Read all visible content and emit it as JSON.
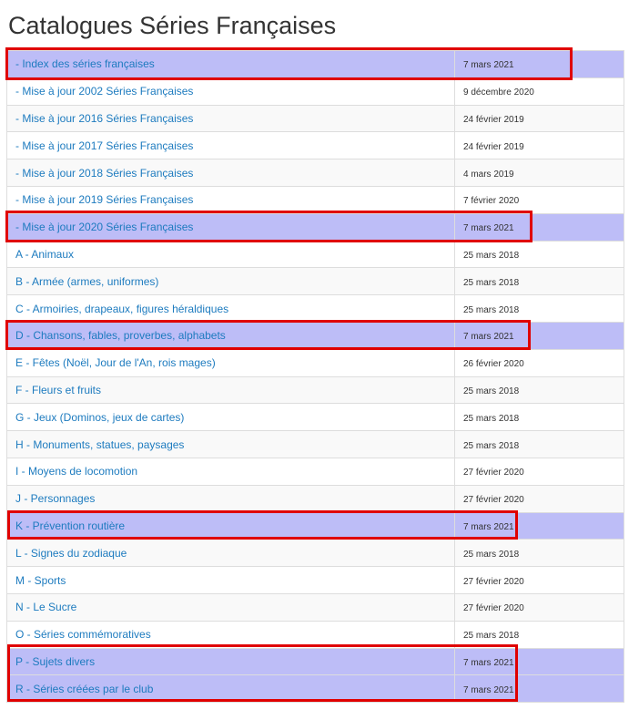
{
  "title": "Catalogues Séries Françaises",
  "highlight_color": "#bdbdf7",
  "box_color": "#e00000",
  "link_color": "#1d7bbf",
  "rows": [
    {
      "label": "- Index des séries françaises",
      "date": "7 mars 2021",
      "highlighted": true
    },
    {
      "label": "- Mise à jour 2002 Séries Françaises",
      "date": "9 décembre 2020",
      "highlighted": false
    },
    {
      "label": "- Mise à jour 2016 Séries Françaises",
      "date": "24 février 2019",
      "highlighted": false
    },
    {
      "label": "- Mise à jour 2017 Séries Françaises",
      "date": "24 février 2019",
      "highlighted": false
    },
    {
      "label": "- Mise à jour 2018 Séries Françaises",
      "date": "4 mars 2019",
      "highlighted": false
    },
    {
      "label": "- Mise à jour 2019 Séries Françaises",
      "date": "7 février 2020",
      "highlighted": false
    },
    {
      "label": "- Mise à jour 2020 Séries Françaises",
      "date": "7 mars 2021",
      "highlighted": true
    },
    {
      "label": "A - Animaux",
      "date": "25 mars 2018",
      "highlighted": false
    },
    {
      "label": "B - Armée (armes, uniformes)",
      "date": "25 mars 2018",
      "highlighted": false
    },
    {
      "label": "C - Armoiries, drapeaux, figures héraldiques",
      "date": "25 mars 2018",
      "highlighted": false
    },
    {
      "label": "D - Chansons, fables, proverbes, alphabets",
      "date": "7 mars 2021",
      "highlighted": true
    },
    {
      "label": "E - Fêtes (Noël, Jour de l'An, rois mages)",
      "date": "26 février 2020",
      "highlighted": false
    },
    {
      "label": "F - Fleurs et fruits",
      "date": "25 mars 2018",
      "highlighted": false
    },
    {
      "label": "G - Jeux (Dominos, jeux de cartes)",
      "date": "25 mars 2018",
      "highlighted": false
    },
    {
      "label": "H - Monuments, statues, paysages",
      "date": "25 mars 2018",
      "highlighted": false
    },
    {
      "label": "I - Moyens de locomotion",
      "date": "27 février 2020",
      "highlighted": false
    },
    {
      "label": "J - Personnages",
      "date": "27 février 2020",
      "highlighted": false
    },
    {
      "label": "K - Prévention routière",
      "date": "7 mars 2021",
      "highlighted": true
    },
    {
      "label": "L - Signes du zodiaque",
      "date": "25 mars 2018",
      "highlighted": false
    },
    {
      "label": "M - Sports",
      "date": "27 février 2020",
      "highlighted": false
    },
    {
      "label": "N - Le Sucre",
      "date": "27 février 2020",
      "highlighted": false
    },
    {
      "label": "O - Séries commémoratives",
      "date": "25 mars 2018",
      "highlighted": false
    },
    {
      "label": "P - Sujets divers",
      "date": "7 mars 2021",
      "highlighted": true
    },
    {
      "label": "R - Séries créées par le club",
      "date": "7 mars 2021",
      "highlighted": true
    }
  ]
}
